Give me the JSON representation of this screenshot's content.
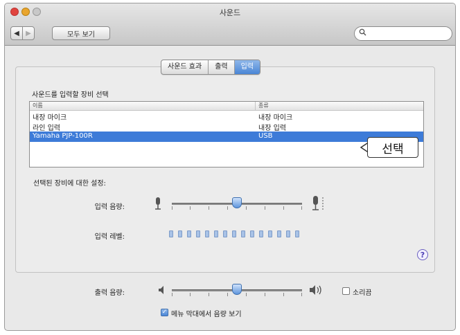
{
  "window": {
    "title": "사운드"
  },
  "toolbar": {
    "back": "◀",
    "forward": "▶",
    "show_all": "모두 보기",
    "search_placeholder": ""
  },
  "tabs": [
    {
      "label": "사운드 효과",
      "active": false
    },
    {
      "label": "출력",
      "active": false
    },
    {
      "label": "입력",
      "active": true
    }
  ],
  "input_section": {
    "title": "사운드를 입력할 장비 선택",
    "columns": [
      "이름",
      "종류"
    ],
    "devices": [
      {
        "name": "내장 마이크",
        "type": "내장 마이크",
        "selected": false
      },
      {
        "name": "라인 입력",
        "type": "내장 입력",
        "selected": false
      },
      {
        "name": "Yamaha PJP-100R",
        "type": "USB",
        "selected": true
      }
    ]
  },
  "callout": {
    "label": "선택"
  },
  "settings": {
    "title": "선택된 장비에 대한 설정:",
    "input_volume_label": "입력 음량:",
    "input_volume": 0.5,
    "input_level_label": "입력 레벨:",
    "input_level_segments": 15
  },
  "output": {
    "volume_label": "출력 음량:",
    "volume": 0.5,
    "mute_label": "소리끔",
    "mute_checked": false,
    "menubar_label": "메뉴 막대에서 음량 보기",
    "menubar_checked": true
  },
  "colors": {
    "selection": "#3d7bd8",
    "accent": "#4a86d6"
  }
}
